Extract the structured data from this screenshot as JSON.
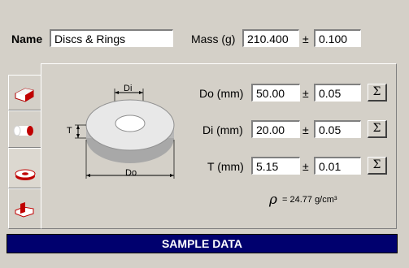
{
  "header": {
    "name_label": "Name",
    "name_value": "Discs & Rings",
    "mass_label": "Mass (g)",
    "mass_value": "210.400",
    "mass_pm": "±",
    "mass_tol": "0.100"
  },
  "dims": [
    {
      "label": "Do (mm)",
      "value": "50.00",
      "pm": "±",
      "tol": "0.05",
      "button": "Σ"
    },
    {
      "label": "Di (mm)",
      "value": "20.00",
      "pm": "±",
      "tol": "0.05",
      "button": "Σ"
    },
    {
      "label": "T (mm)",
      "value": "5.15",
      "pm": "±",
      "tol": "0.01",
      "button": "Σ"
    }
  ],
  "density": {
    "symbol": "ρ",
    "text": "= 24.77 g/cm³"
  },
  "diagram": {
    "di_label": "Di",
    "do_label": "Do",
    "t_label": "T"
  },
  "tabs": [
    {
      "icon": "block-shape-icon",
      "active": false
    },
    {
      "icon": "cylinder-shape-icon",
      "active": false
    },
    {
      "icon": "ring-shape-icon",
      "active": true
    },
    {
      "icon": "custom-shape-icon",
      "active": false
    }
  ],
  "footer": {
    "sample_label": "SAMPLE DATA"
  },
  "colors": {
    "background": "#d4d0c8",
    "sample_bar": "#00006e"
  }
}
